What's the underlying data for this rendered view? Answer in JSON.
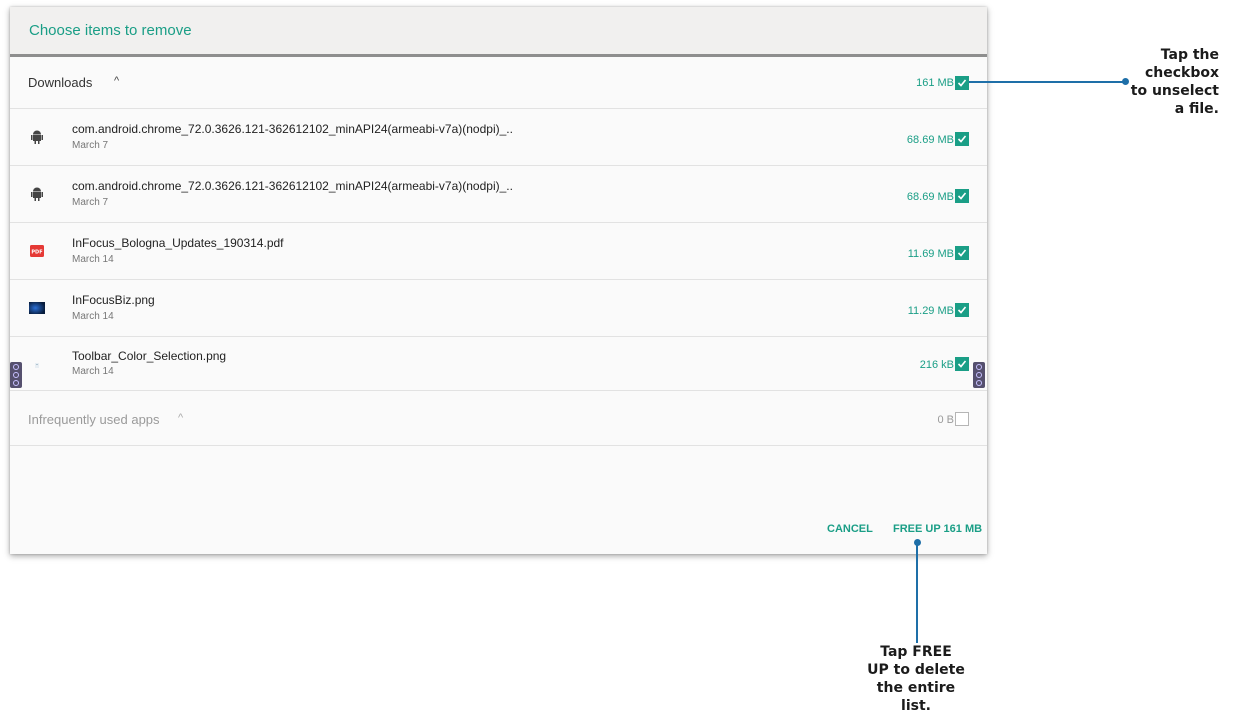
{
  "dialog": {
    "title": "Choose items to remove",
    "downloads": {
      "label": "Downloads",
      "size": "161 MB"
    },
    "files": [
      {
        "name": "com.android.chrome_72.0.3626.121-362612102_minAPI24(armeabi-v7a)(nodpi)_..",
        "date": "March 7",
        "size": "68.69 MB",
        "icon": "android-icon"
      },
      {
        "name": "com.android.chrome_72.0.3626.121-362612102_minAPI24(armeabi-v7a)(nodpi)_..",
        "date": "March 7",
        "size": "68.69 MB",
        "icon": "android-icon"
      },
      {
        "name": "InFocus_Bologna_Updates_190314.pdf",
        "date": "March 14",
        "size": "11.69 MB",
        "icon": "pdf-icon"
      },
      {
        "name": "InFocusBiz.png",
        "date": "March 14",
        "size": "11.29 MB",
        "icon": "image-thumbnail-icon"
      },
      {
        "name": "Toolbar_Color_Selection.png",
        "date": "March 14",
        "size": "216 kB",
        "icon": "image-thumbnail-icon"
      }
    ],
    "infrequent": {
      "label": "Infrequently used apps",
      "size": "0 B"
    },
    "cancel_label": "CANCEL",
    "free_up_label": "FREE UP 161 MB",
    "accent_color": "#1a9e86"
  },
  "callouts": {
    "checkbox_tip": [
      "Tap the",
      "checkbox",
      "to unselect",
      "a file."
    ],
    "free_up_tip": [
      "Tap FREE",
      "UP to delete",
      "the entire",
      "list."
    ],
    "line_color": "#1e6fa8"
  }
}
